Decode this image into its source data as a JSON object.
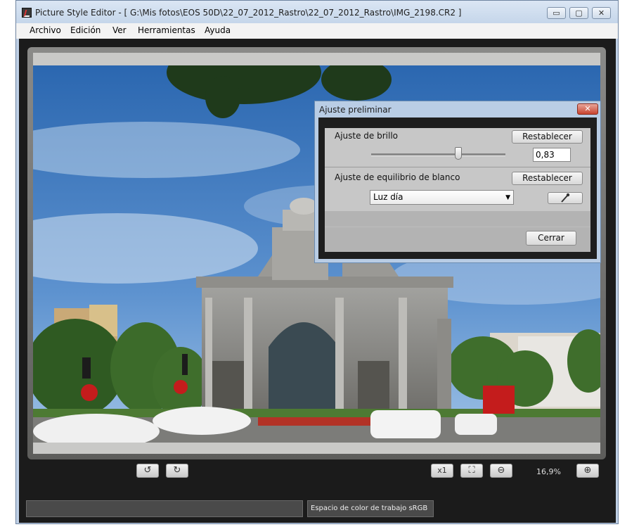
{
  "window": {
    "title": "Picture Style Editor - [ G:\\Mis fotos\\EOS 50D\\22_07_2012_Rastro\\22_07_2012_Rastro\\IMG_2198.CR2 ]",
    "controls": {
      "minimize": "▭",
      "maximize": "▢",
      "close": "✕"
    }
  },
  "menu": [
    "Archivo",
    "Edición",
    "Ver",
    "Herramientas",
    "Ayuda"
  ],
  "toolbar": {
    "rotate_left_icon": "↺",
    "rotate_right_icon": "↻",
    "zoom_1x_label": "x1",
    "fit_icon": "⛶",
    "zoom_out_icon": "⊖",
    "zoom_value": "16,9%",
    "zoom_in_icon": "⊕"
  },
  "status": {
    "left_field": "",
    "color_space": "Espacio de color de trabajo sRGB"
  },
  "dialog": {
    "title": "Ajuste preliminar",
    "close_icon": "✕",
    "brightness_label": "Ajuste de brillo",
    "brightness_reset": "Restablecer",
    "brightness_value": "0,83",
    "brightness_fraction": 0.65,
    "wb_label": "Ajuste de equilibrio de blanco",
    "wb_reset": "Restablecer",
    "wb_selected": "Luz día",
    "close_button": "Cerrar"
  }
}
